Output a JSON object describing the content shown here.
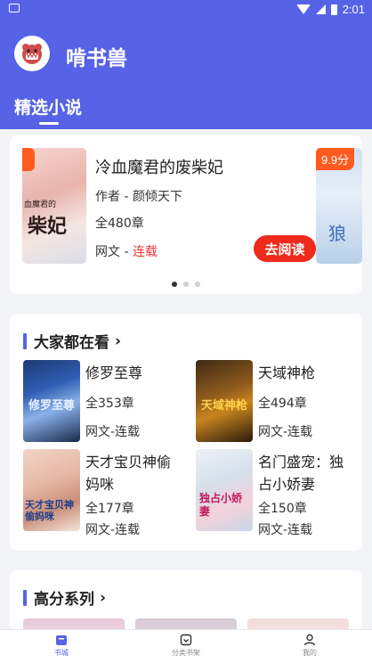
{
  "status_bar": {
    "time": "2:01"
  },
  "header": {
    "app_title": "啃书兽",
    "tab_label": "精选小说"
  },
  "carousel": {
    "book": {
      "title": "冷血魔君的废柴妃",
      "author": "作者 - 颜倾天下",
      "chapters": "全480章",
      "source": "网文 - ",
      "status": "连载",
      "read_button": "去阅读",
      "cover_title_big": "柴妃",
      "cover_title_small": "血魔君的"
    },
    "peek_rating": "9.9分",
    "peek_cover_text": "狼",
    "slides": 3,
    "active_slide": 1
  },
  "section_popular": {
    "title": "大家都在看",
    "arrow": "›",
    "items": [
      {
        "title": "修罗至尊",
        "chapters": "全353章",
        "meta": "网文-连载",
        "cover_text": "修罗至尊"
      },
      {
        "title": "天域神枪",
        "chapters": "全494章",
        "meta": "网文-连载",
        "cover_text": "天域神枪"
      },
      {
        "title": "天才宝贝神偷妈咪",
        "chapters": "全177章",
        "meta": "网文-连载",
        "cover_text": "天才宝贝神偷妈咪"
      },
      {
        "title": "名门盛宠：独占小娇妻",
        "chapters": "全150章",
        "meta": "网文-连载",
        "cover_text": "独占小娇妻"
      }
    ]
  },
  "section_high": {
    "title": "高分系列",
    "arrow": "›"
  },
  "bottom_nav": {
    "items": [
      {
        "label": "书城",
        "active": true
      },
      {
        "label": "分类书架",
        "active": false
      },
      {
        "label": "我的",
        "active": false
      }
    ]
  },
  "colors": {
    "primary": "#5663e6",
    "accent_red": "#ee2a1c",
    "rating_orange": "#ff5a1f"
  }
}
